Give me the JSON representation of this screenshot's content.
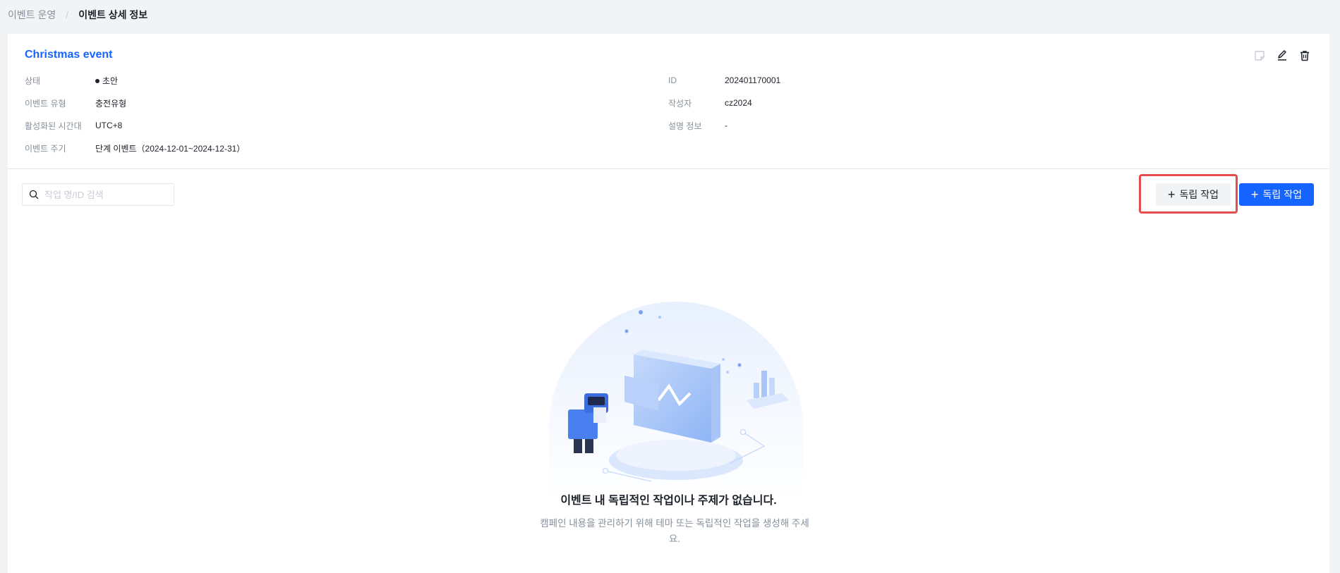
{
  "breadcrumb": {
    "parent": "이벤트 운영",
    "separator": "/",
    "current": "이벤트 상세 정보"
  },
  "event": {
    "title": "Christmas event",
    "fields_left": [
      {
        "label": "상태",
        "value": "초안"
      },
      {
        "label": "이벤트 유형",
        "value": "충전유형"
      },
      {
        "label": "활성화된 시간대",
        "value": "UTC+8"
      },
      {
        "label": "이벤트 주기",
        "value": "단계 이벤트（2024-12-01~2024-12-31）"
      }
    ],
    "fields_right": [
      {
        "label": "ID",
        "value": "202401170001"
      },
      {
        "label": "작성자",
        "value": "cz2024"
      },
      {
        "label": "설명 정보",
        "value": "-"
      }
    ],
    "actions": [
      "note-icon",
      "edit-icon",
      "delete-icon"
    ]
  },
  "toolbar": {
    "search_placeholder": "작업 명/ID 검색",
    "secondary_button": "독립 작업",
    "primary_button": "독립 작업",
    "plus": "+"
  },
  "empty": {
    "title": "이벤트 내 독립적인 작업이나 주제가 없습니다.",
    "description_line1": "캠페인 내용을 관리하기 위해 테마 또는 독립적인 작업을 생성해 주세",
    "description_line2": "요."
  },
  "colors": {
    "accent": "#1664ff",
    "highlight": "#e74c4c",
    "background": "#f2f3f5"
  }
}
